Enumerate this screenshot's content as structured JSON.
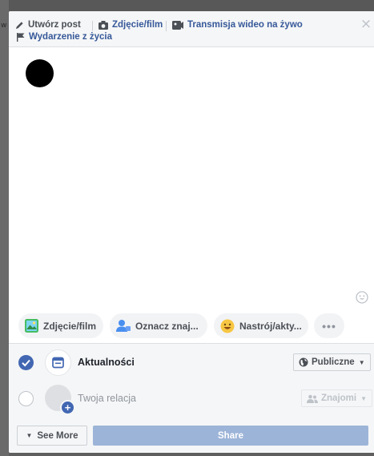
{
  "header": {
    "create_post": "Utwórz post",
    "photo_video": "Zdjęcie/film",
    "live_video": "Transmisja wideo na żywo",
    "life_event": "Wydarzenie z życia",
    "close": "×"
  },
  "composer": {
    "placeholder": ""
  },
  "actions": [
    {
      "label": "Zdjęcie/film",
      "icon": "photo-icon"
    },
    {
      "label": "Oznacz znaj...",
      "icon": "tag-friends-icon"
    },
    {
      "label": "Nastrój/akty...",
      "icon": "feeling-emoji-icon"
    },
    {
      "label": "•••",
      "icon": "more-dots"
    }
  ],
  "destinations": {
    "news_feed": {
      "label": "Aktualności",
      "audience": "Publiczne",
      "checked": true
    },
    "story": {
      "label": "Twoja relacja",
      "audience": "Znajomi",
      "checked": false
    }
  },
  "footer": {
    "see_more": "See More",
    "share": "Share"
  },
  "colors": {
    "accent": "#4267b2",
    "share_disabled": "#9cb4d8",
    "link": "#365899"
  }
}
